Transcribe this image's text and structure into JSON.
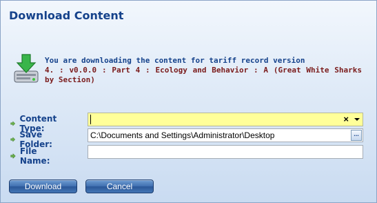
{
  "dialog": {
    "title": "Download Content"
  },
  "message": {
    "lead": "You are downloading the content for tariff record version",
    "record": "4. : v0.0.0 : Part 4 : Ecology and Behavior : A (Great White Sharks by Section)"
  },
  "form": {
    "content_type": {
      "label": "Content Type:",
      "value": ""
    },
    "save_folder": {
      "label": "Save Folder:",
      "value": "C:\\Documents and Settings\\Administrator\\Desktop",
      "browse_label": "..."
    },
    "file_name": {
      "label": "File Name:",
      "value": ""
    }
  },
  "buttons": {
    "download": "Download",
    "cancel": "Cancel"
  },
  "icons": {
    "clear": "×"
  },
  "colors": {
    "title": "#15428b",
    "record_text": "#7a1b1b",
    "combo_background": "#ffff99",
    "button": "#2a5697"
  }
}
